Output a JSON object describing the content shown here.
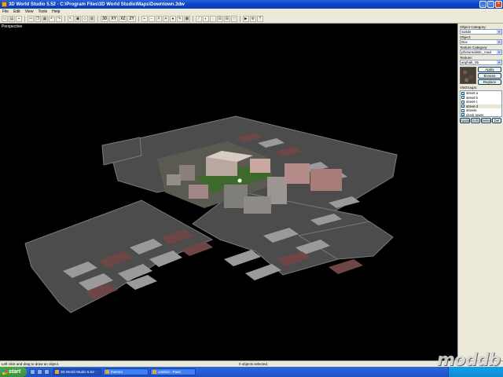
{
  "window": {
    "title": "3D World Studio 5.52 - C:\\Program Files\\3D World Studio\\Maps\\Downtown.3dw",
    "controls": [
      "_",
      "□",
      "×"
    ]
  },
  "menu": [
    "File",
    "Edit",
    "View",
    "Tools",
    "Help"
  ],
  "toolbar": {
    "view_labels": [
      "3D",
      "XY",
      "XZ",
      "ZY"
    ]
  },
  "viewport": {
    "label": "Perspective"
  },
  "panel": {
    "object_category_label": "Object Category:",
    "object_category_value": "Solids",
    "object_label": "Object:",
    "object_value": "Box",
    "texture_category_label": "Texture Category:",
    "texture_category_value": "photorealistic_road",
    "texture_label": "Texture:",
    "texture_value": "asphalt_05",
    "apply_label": "Apply",
    "browse_label": "Browse",
    "replace_label": "Replace",
    "visgroups_label": "VisGroups:",
    "visgroups": [
      "street a",
      "street b",
      "street c",
      "street d",
      "streets",
      "clock tower"
    ],
    "vg_apply": "Apply",
    "vg_edit": "Edit",
    "vg_select": "Select",
    "vg_delete": "Del"
  },
  "status": {
    "hint": "Left click and drag to draw an object.",
    "selection": "0 objects selected."
  },
  "taskbar": {
    "start_label": "start",
    "tasks": [
      "3D World Studio 5.52 -",
      "thetmto",
      "untitled - Paint"
    ]
  },
  "watermark": "moddb"
}
